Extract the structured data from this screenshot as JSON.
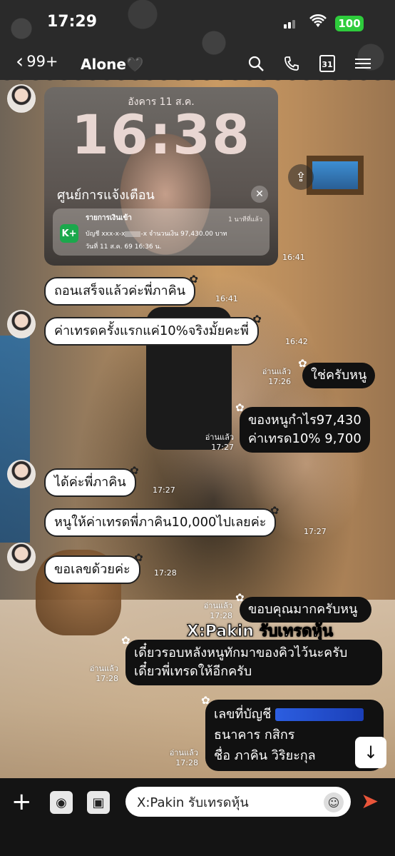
{
  "status_bar": {
    "time": "17:29",
    "battery": "100"
  },
  "header": {
    "back_count": "99+",
    "title": "Alone🖤",
    "calendar_day": "31"
  },
  "screenshot": {
    "date": "อังคาร 11 ส.ค.",
    "clock": "16:38",
    "center_title": "ศูนย์การแจ้งเตือน",
    "notification": {
      "app_badge": "K+",
      "title": "รายการเงินเข้า",
      "time_ago": "1 นาทีที่แล้ว",
      "account_prefix": "บัญชี xxx-x-x",
      "account_suffix": "-x  จำนวนเงิน 97,430.00 บาท",
      "date_line": "วันที่ 11 ส.ค. 69 16:36 น."
    },
    "sent_time": "16:41"
  },
  "messages": [
    {
      "text": "ถอนเสร็จแล้วค่ะพี่ภาคิน",
      "time": "16:41"
    },
    {
      "text": "ค่าเทรดครั้งแรกแค่10%จริงมั้ยคะพี่",
      "time": "16:42"
    },
    {
      "text": "ใช่ครับหนู",
      "read": "อ่านแล้ว",
      "time": "17:26"
    },
    {
      "line1": "ของหนูกำไร97,430",
      "line2": "ค่าเทรด10% 9,700",
      "read": "อ่านแล้ว",
      "time": "17:27"
    },
    {
      "text": "ได้ค่ะพี่ภาคิน",
      "time": "17:27"
    },
    {
      "text": "หนูให้ค่าเทรดพี่ภาคิน10,000ไปเลยค่ะ",
      "time": "17:27"
    },
    {
      "text": "ขอเลขด้วยค่ะ",
      "time": "17:28"
    },
    {
      "text": "ขอบคุณมากครับหนู",
      "read": "อ่านแล้ว",
      "time": "17:28"
    },
    {
      "line1": "เดี๋ยวรอบหลังหนูทักมาของคิวไว้นะครับ",
      "line2": "เดี๋ยวพี่เทรดให้อีกครับ",
      "read": "อ่านแล้ว",
      "time": "17:28"
    },
    {
      "line1": "เลขที่บัญชี",
      "line2": "ธนาคาร กสิกร",
      "line3": "ชื่อ ภาคิน วิริยะกุล",
      "read": "อ่านแล้ว",
      "time": "17:28"
    }
  ],
  "watermark": "X:Pakin รับเทรดหุ้น",
  "input": {
    "value": "X:Pakin รับเทรดหุ้น"
  },
  "icons": [
    "back-chevron-icon",
    "search-icon",
    "phone-icon",
    "calendar-icon",
    "menu-icon",
    "share-icon",
    "close-icon",
    "scroll-down-icon",
    "plus-icon",
    "camera-icon",
    "image-icon",
    "sticker-icon",
    "send-icon"
  ],
  "colors": {
    "incoming_bubble": "#ffffff",
    "outgoing_bubble": "#111111",
    "battery": "#2ecc3c",
    "send": "#e9553a",
    "redaction": "#2c5ee0"
  }
}
